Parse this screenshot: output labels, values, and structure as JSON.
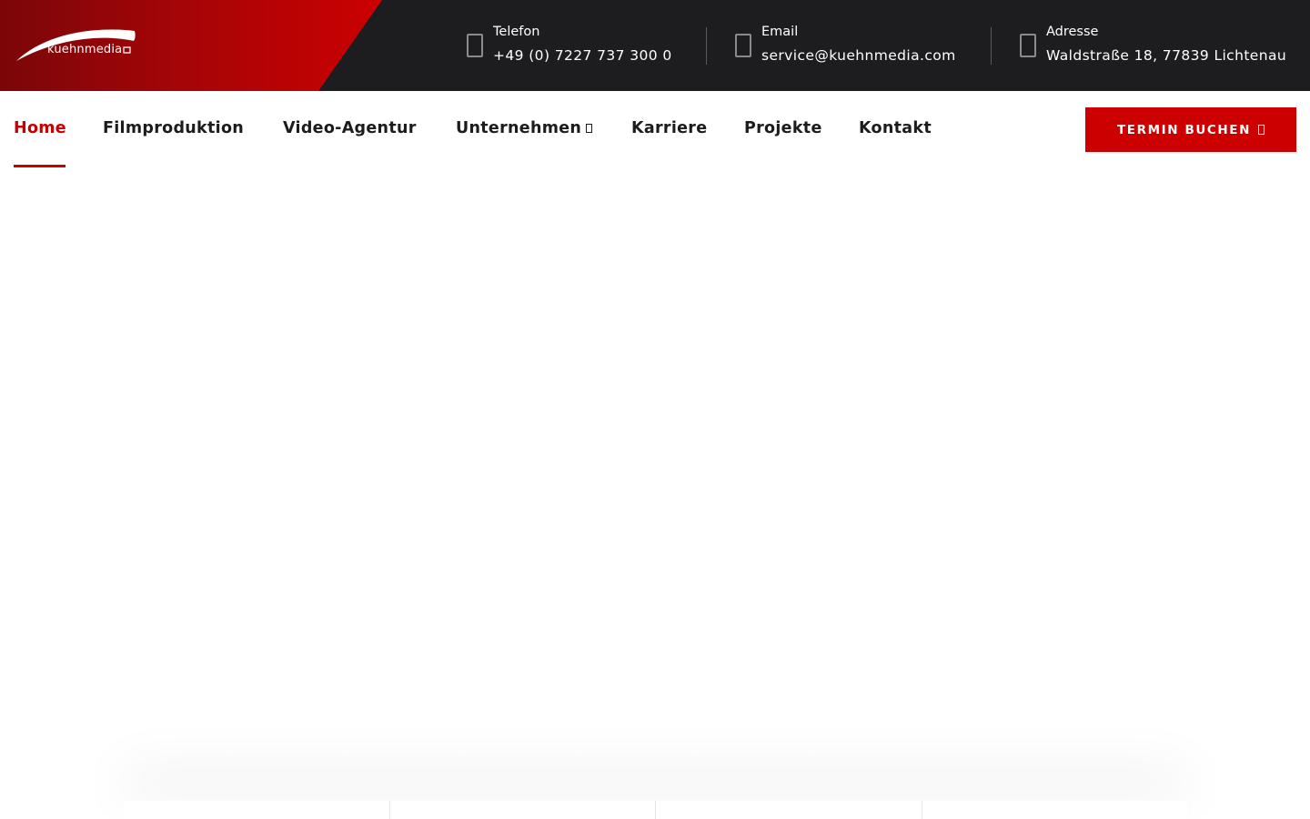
{
  "brand": {
    "logo_text": "kuehnmedia",
    "colors": {
      "accent": "#cc0000",
      "topbar": "#1d1d1f",
      "brand_dark": "#7a0608"
    }
  },
  "contacts": [
    {
      "icon": "phone-icon",
      "label": "Telefon",
      "value": "+49 (0) 7227 737 300 0"
    },
    {
      "icon": "email-icon",
      "label": "Email",
      "value": "service@kuehnmedia.com"
    },
    {
      "icon": "location-icon",
      "label": "Adresse",
      "value": "Waldstraße 18, 77839 Lichtenau"
    }
  ],
  "nav": {
    "items": [
      {
        "label": "Home",
        "active": true
      },
      {
        "label": "Filmproduktion"
      },
      {
        "label": "Video-Agentur"
      },
      {
        "label": "Unternehmen",
        "has_dropdown": true
      },
      {
        "label": "Karriere"
      },
      {
        "label": "Projekte"
      },
      {
        "label": "Kontakt"
      }
    ],
    "cta_label": "TERMIN BUCHEN"
  }
}
